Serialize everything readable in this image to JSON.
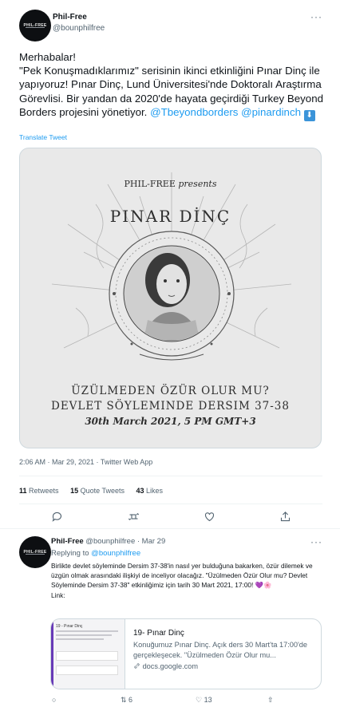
{
  "tweet": {
    "display_name": "Phil-Free",
    "handle": "@bounphilfree",
    "more": "···",
    "text_line1": "Merhabalar!",
    "text_body": "\"Pek Konuşmadıklarımız\" serisinin ikinci etkinliğini Pınar Dinç ile yapıyoruz! Pınar Dinç, Lund Üniversitesi'nde Doktoralı Araştırma Görevlisi. Bir yandan da 2020'de hayata geçirdiği Turkey Beyond Borders projesini yönetiyor.",
    "mention1": "@Tbeyondborders",
    "mention2": "@pinardinch",
    "emoji_arrow": "⬇",
    "translate": "Translate Tweet",
    "timestamp": "2:06 AM · Mar 29, 2021 · Twitter Web App",
    "stats": {
      "retweets_count": "11",
      "retweets_label": "Retweets",
      "quotes_count": "15",
      "quotes_label": "Quote Tweets",
      "likes_count": "43",
      "likes_label": "Likes"
    }
  },
  "poster": {
    "presenter": "PHIL-FREE",
    "presents": "presents",
    "speaker": "PINAR DİNÇ",
    "title1": "ÜZÜLMEDEN ÖZÜR OLUR MU?",
    "title2": "DEVLET SÖYLEMINDE DERSIM 37-38",
    "date": "30th March 2021, 5 PM GMT+3"
  },
  "avatar": {
    "logo_text": "PHIL-FREE"
  },
  "reply": {
    "display_name": "Phil-Free",
    "handle": "@bounphilfree",
    "date": "· Mar 29",
    "replying_label": "Replying to",
    "replying_handle": "@bounphilfree",
    "text": "Birlikte devlet söyleminde Dersim 37-38'in nasıl yer bulduğuna bakarken, özür dilemek ve üzgün olmak arasındaki ilişkiyi de inceliyor olacağız. \"Üzülmeden Özür Olur mu? Devlet Söyleminde Dersim 37-38\" etkinliğimiz için tarih 30 Mart 2021, 17:00! 💜🌸",
    "link_label": "Link:",
    "card": {
      "title": "19- Pınar Dinç",
      "description": "Konuğumuz Pınar Dinç. Açık ders 30 Mart'ta 17:00'de gerçekleşecek. \"Üzülmeden Özür Olur mu...",
      "domain": "docs.google.com",
      "thumb_title": "19 - Pınar Dinç"
    },
    "retweets_count": "6",
    "likes_count": "13"
  },
  "colors": {
    "accent": "#1d9bf0",
    "text": "#0f1419",
    "muted": "#536471",
    "border": "#cfd9de",
    "poster_bg": "#e9e9e9"
  },
  "icons": [
    "more-icon",
    "reply-icon",
    "retweet-icon",
    "like-icon",
    "share-icon",
    "link-icon"
  ]
}
